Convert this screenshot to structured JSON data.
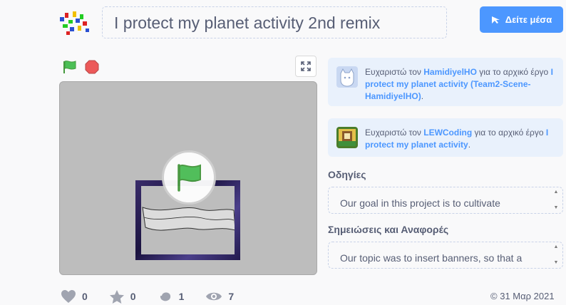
{
  "project": {
    "title": "I protect my planet activity 2nd remix",
    "see_inside_label": "Δείτε μέσα"
  },
  "credits": [
    {
      "prefix": "Ευχαριστώ τον ",
      "author": "HamidiyelHO",
      "middle": " για το αρχικό έργο ",
      "project": "I protect my planet activity (Team2-Scene- HamidiyelHO)",
      "suffix": "."
    },
    {
      "prefix": "Ευχαριστώ τον ",
      "author": "LEWCoding",
      "middle": " για το αρχικό έργο ",
      "project": "I protect my planet activity",
      "suffix": "."
    }
  ],
  "instructions": {
    "heading": "Οδηγίες",
    "text": "Our goal in this project is to cultivate"
  },
  "notes": {
    "heading": "Σημειώσεις και Αναφορές",
    "text": "Our topic was to insert banners, so that a"
  },
  "stats": {
    "loves": "0",
    "favorites": "0",
    "remixes": "1",
    "views": "7"
  },
  "date": "31 Μαρ 2021",
  "colors": {
    "accent": "#4c97ff",
    "credit_bg": "#e9f1fc",
    "text": "#575e75",
    "flag_green": "#4cbf56",
    "stop_red": "#ec5959"
  }
}
